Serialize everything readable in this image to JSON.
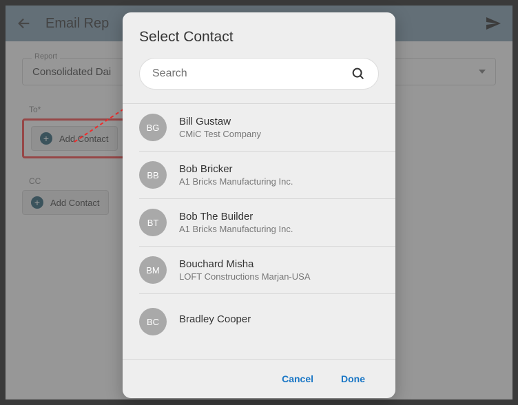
{
  "bg": {
    "title": "Email Rep",
    "report_label": "Report",
    "report_value": "Consolidated Dai",
    "to_label": "To*",
    "cc_label": "CC",
    "add_contact_label": "Add Contact"
  },
  "modal": {
    "title": "Select Contact",
    "search_placeholder": "Search",
    "cancel": "Cancel",
    "done": "Done",
    "contacts": [
      {
        "initials": "BG",
        "name": "Bill Gustaw",
        "company": "CMiC Test Company"
      },
      {
        "initials": "BB",
        "name": "Bob Bricker",
        "company": "A1 Bricks Manufacturing Inc."
      },
      {
        "initials": "BT",
        "name": "Bob The Builder",
        "company": "A1 Bricks Manufacturing Inc."
      },
      {
        "initials": "BM",
        "name": "Bouchard Misha",
        "company": "LOFT Constructions Marjan-USA"
      },
      {
        "initials": "BC",
        "name": "Bradley Cooper",
        "company": ""
      }
    ]
  }
}
